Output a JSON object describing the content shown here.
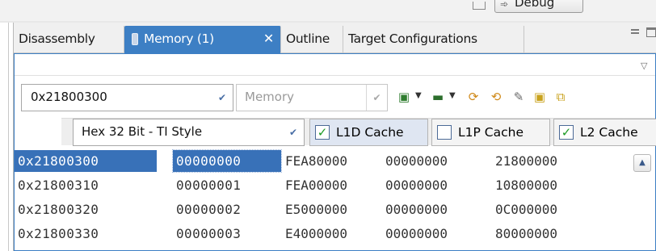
{
  "perspective": {
    "debug_label": "Debug"
  },
  "tabs": [
    {
      "label": "Disassembly"
    },
    {
      "label": "Memory (1)"
    },
    {
      "label": "Outline"
    },
    {
      "label": "Target Configurations"
    }
  ],
  "active_tab_close": "✕",
  "toolbar": {
    "address_value": "0x21800300",
    "rendering_placeholder": "Memory",
    "format_value": "Hex 32 Bit - TI Style",
    "icons": [
      "refresh-icon",
      "memory-chip-icon",
      "link-icon",
      "sync-icon",
      "export-icon",
      "lock-icon",
      "new-window-icon"
    ]
  },
  "cache": [
    {
      "label": "L1D Cache",
      "checked": true
    },
    {
      "label": "L1P Cache",
      "checked": false
    },
    {
      "label": "L2 Cache",
      "checked": true
    }
  ],
  "memory": {
    "rows": [
      {
        "address": "0x21800300",
        "words": [
          "00000000",
          "FEA80000",
          "00000000",
          "21800000"
        ]
      },
      {
        "address": "0x21800310",
        "words": [
          "00000001",
          "FEA00000",
          "00000000",
          "10800000"
        ]
      },
      {
        "address": "0x21800320",
        "words": [
          "00000002",
          "E5000000",
          "00000000",
          "0C000000"
        ]
      },
      {
        "address": "0x21800330",
        "words": [
          "00000003",
          "E4000000",
          "00000000",
          "80000000"
        ]
      }
    ]
  },
  "colors": {
    "accent": "#3d7fc4",
    "selection": "#3871b8",
    "check_green": "#1b9a23"
  }
}
